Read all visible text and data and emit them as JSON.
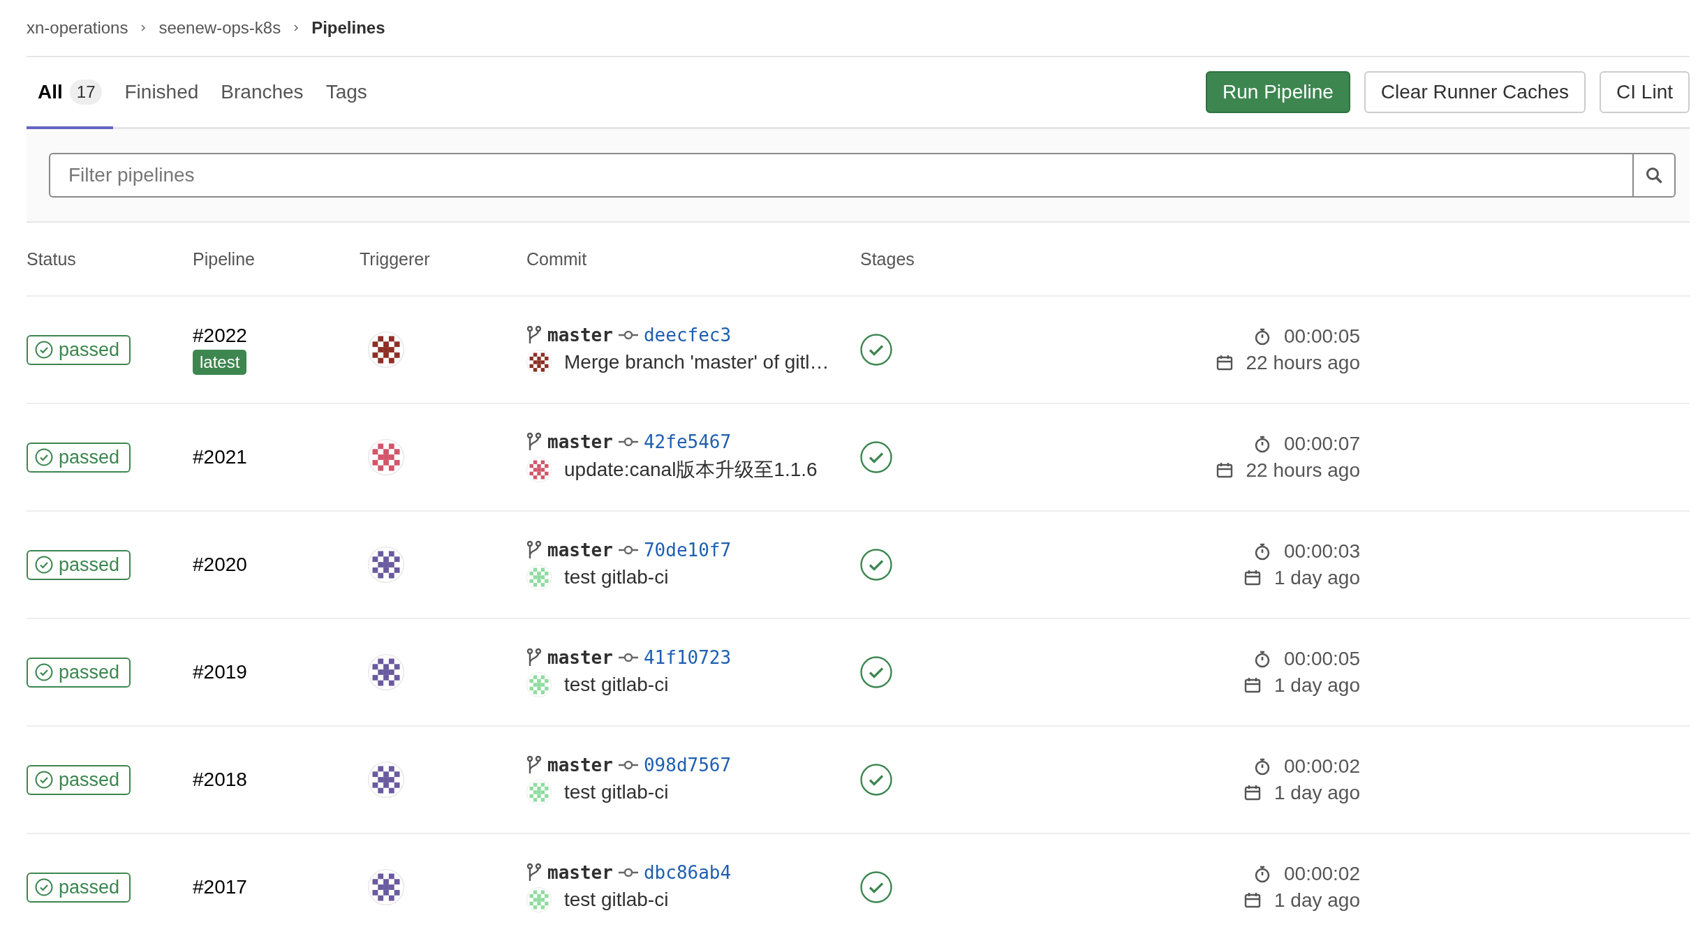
{
  "breadcrumbs": [
    {
      "label": "xn-operations",
      "current": false
    },
    {
      "label": "seenew-ops-k8s",
      "current": false
    },
    {
      "label": "Pipelines",
      "current": true
    }
  ],
  "tabs": [
    {
      "label": "All",
      "count": "17",
      "selected": true
    },
    {
      "label": "Finished",
      "selected": false
    },
    {
      "label": "Branches",
      "selected": false
    },
    {
      "label": "Tags",
      "selected": false
    }
  ],
  "buttons": [
    {
      "label": "Run Pipeline",
      "kind": "primary"
    },
    {
      "label": "Clear Runner Caches",
      "kind": "default"
    },
    {
      "label": "CI Lint",
      "kind": "default"
    }
  ],
  "search": {
    "placeholder": "Filter pipelines"
  },
  "table": {
    "columns": [
      "Status",
      "Pipeline",
      "Triggerer",
      "Commit",
      "Stages"
    ],
    "rows": [
      {
        "status": "passed",
        "pipeline": "#2022",
        "badges": [
          "latest"
        ],
        "triggerer": {
          "color": "#8c2f24"
        },
        "branch": "master",
        "sha": "deecfec3",
        "author": {
          "color": "#8c2f24"
        },
        "message": "Merge branch 'master' of gitl…",
        "stages": [
          {
            "passed": true
          }
        ],
        "duration": "00:00:05",
        "finished": "22 hours ago"
      },
      {
        "status": "passed",
        "pipeline": "#2021",
        "triggerer": {
          "color": "#d0566b"
        },
        "branch": "master",
        "sha": "42fe5467",
        "author": {
          "color": "#d0566b"
        },
        "message": "update:canal版本升级至1.1.6",
        "stages": [
          {
            "passed": true
          }
        ],
        "duration": "00:00:07",
        "finished": "22 hours ago"
      },
      {
        "status": "passed",
        "pipeline": "#2020",
        "triggerer": {
          "color": "#6a5a9e"
        },
        "branch": "master",
        "sha": "70de10f7",
        "author": {
          "color": "#8edc9f"
        },
        "message": "test gitlab-ci",
        "stages": [
          {
            "passed": true
          }
        ],
        "duration": "00:00:03",
        "finished": "1 day ago"
      },
      {
        "status": "passed",
        "pipeline": "#2019",
        "triggerer": {
          "color": "#6a5a9e"
        },
        "branch": "master",
        "sha": "41f10723",
        "author": {
          "color": "#8edc9f"
        },
        "message": "test gitlab-ci",
        "stages": [
          {
            "passed": true
          }
        ],
        "duration": "00:00:05",
        "finished": "1 day ago"
      },
      {
        "status": "passed",
        "pipeline": "#2018",
        "triggerer": {
          "color": "#6a5a9e"
        },
        "branch": "master",
        "sha": "098d7567",
        "author": {
          "color": "#8edc9f"
        },
        "message": "test gitlab-ci",
        "stages": [
          {
            "passed": true
          }
        ],
        "duration": "00:00:02",
        "finished": "1 day ago"
      },
      {
        "status": "passed",
        "pipeline": "#2017",
        "triggerer": {
          "color": "#6a5a9e"
        },
        "branch": "master",
        "sha": "dbc86ab4",
        "author": {
          "color": "#8edc9f"
        },
        "message": "test gitlab-ci",
        "stages": [
          {
            "passed": true
          }
        ],
        "duration": "00:00:02",
        "finished": "1 day ago"
      }
    ]
  }
}
